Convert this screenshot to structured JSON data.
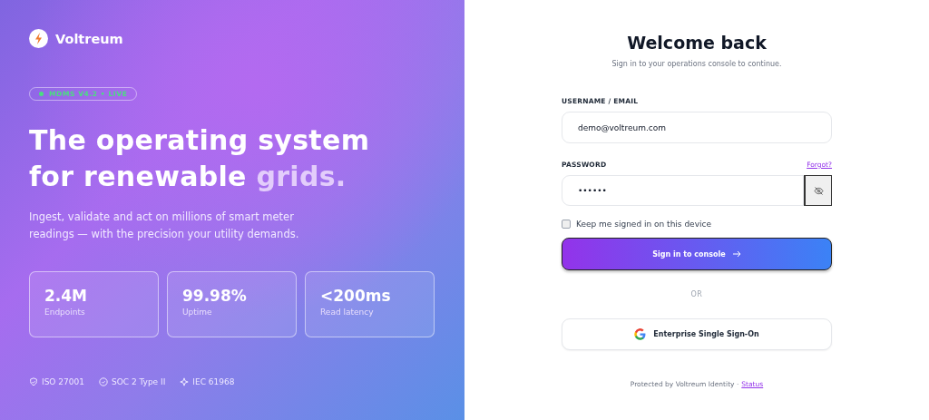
{
  "hero": {
    "brand": "Voltreum",
    "badge": {
      "text": "MDMS V4.2 • LIVE",
      "color": "#4ade80"
    },
    "headline": {
      "lead": "The operating system for renewable",
      "accent": "grids."
    },
    "description": "Ingest, validate and act on millions of smart meter readings — with the precision your utility demands.",
    "stats": [
      {
        "value": "2.4M",
        "label": "Endpoints"
      },
      {
        "value": "99.98%",
        "label": "Uptime"
      },
      {
        "value": "<200ms",
        "label": "Read latency"
      }
    ],
    "certifications": [
      {
        "kind": "shield",
        "text": "ISO 27001"
      },
      {
        "kind": "check",
        "text": "SOC 2 Type II"
      },
      {
        "kind": "spark",
        "text": "IEC 61968"
      }
    ]
  },
  "form": {
    "title": "Welcome back",
    "subtitle": "Sign in to your operations console to continue.",
    "username": {
      "label": "USERNAME / EMAIL",
      "value": "demo@voltreum.com"
    },
    "password": {
      "label": "PASSWORD",
      "value": "••••••",
      "forgot": "Forgot?"
    },
    "remember": {
      "label": "Keep me signed in on this device",
      "checked": false
    },
    "submit": "Sign in to console",
    "divider": "OR",
    "sso": "Enterprise Single Sign-On",
    "footer": {
      "text": "Protected by Voltreum Identity ·",
      "link": "Status"
    }
  }
}
